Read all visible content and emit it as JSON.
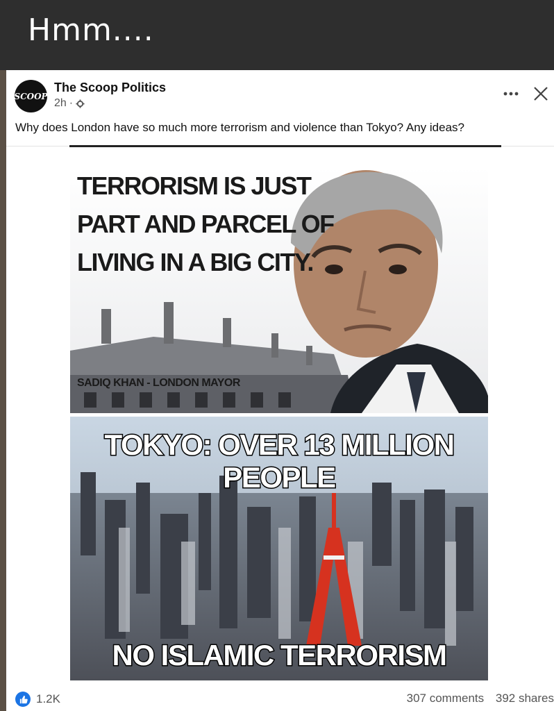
{
  "top_bar": {
    "title": "Hmm...."
  },
  "post": {
    "page_name": "The Scoop Politics",
    "avatar_text": "SCOOP",
    "time": "2h",
    "text": "Why does London have so much more terrorism and violence than Tokyo? Any ideas?"
  },
  "meme": {
    "quote_lines": [
      "TERRORISM IS JUST",
      "PART AND PARCEL OF",
      "LIVING IN A BIG CITY."
    ],
    "attribution": "SADIQ KHAN - LONDON MAYOR",
    "tokyo_line1": "TOKYO: OVER 13 MILLION",
    "tokyo_line2": "PEOPLE",
    "bottom_caption": "NO ISLAMIC TERRORISM"
  },
  "footer": {
    "likes": "1.2K",
    "comments": "307 comments",
    "shares": "392 shares"
  },
  "colors": {
    "like_blue": "#1b74e4",
    "top_bar": "#2e2e2e"
  },
  "icons": [
    "gear-icon",
    "more-icon",
    "close-icon",
    "like-icon"
  ]
}
